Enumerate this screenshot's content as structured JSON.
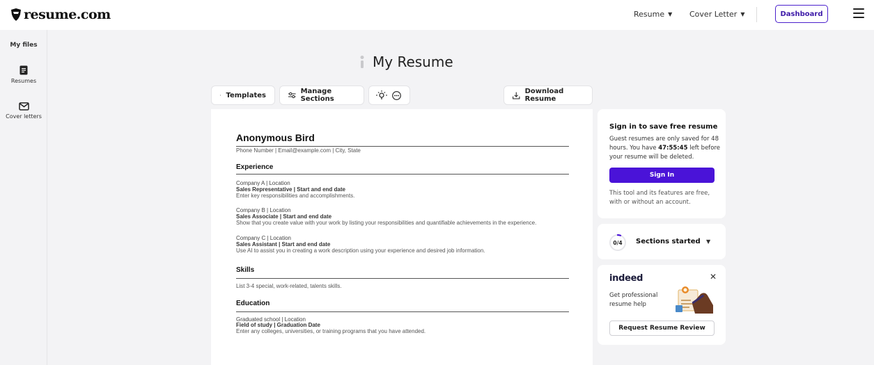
{
  "header": {
    "logo_text": "resume.com",
    "nav": [
      {
        "label": "Resume"
      },
      {
        "label": "Cover Letter"
      }
    ],
    "dashboard_label": "Dashboard"
  },
  "sidebar": {
    "title": "My files",
    "items": [
      {
        "label": "Resumes",
        "icon": "document-icon"
      },
      {
        "label": "Cover letters",
        "icon": "envelope-icon"
      }
    ]
  },
  "page": {
    "title": "My Resume"
  },
  "toolbar": {
    "templates_label": "Templates",
    "manage_sections_label": "Manage Sections",
    "download_label": "Download Resume"
  },
  "resume": {
    "name": "Anonymous Bird",
    "contact": "Phone Number | Email@example.com | City, State",
    "sections": {
      "experience": {
        "title": "Experience",
        "entries": [
          {
            "company": "Company A | Location",
            "role": "Sales Representative | Start and end date",
            "desc": "Enter key responsibilities and accomplishments."
          },
          {
            "company": "Company B | Location",
            "role": "Sales Associate | Start and end date",
            "desc": "Show that you create value with your work by listing your responsibilities and quantifiable achievements in the experience."
          },
          {
            "company": "Company C | Location",
            "role": "Sales Assistant | Start and end date",
            "desc": "Use AI to assist you in creating a work description using your experience and desired job information."
          }
        ]
      },
      "skills": {
        "title": "Skills",
        "desc": "List 3-4 special, work-related, talents skills."
      },
      "education": {
        "title": "Education",
        "school": "Graduated school | Location",
        "field": "Field of study | Graduation Date",
        "desc": "Enter any colleges, universities, or training programs that you have attended."
      }
    }
  },
  "signin_card": {
    "title": "Sign in to save free resume",
    "text_before": "Guest resumes are only saved for 48 hours. You have ",
    "timer": "47:55:45",
    "text_after": " left before your resume will be deleted.",
    "button": "Sign In",
    "note": "This tool and its features are free, with or without an account."
  },
  "sections_card": {
    "progress_label": "0/4",
    "progress_fraction": 0,
    "title": "Sections started"
  },
  "indeed_card": {
    "brand": "indeed",
    "text": "Get professional resume help",
    "button": "Request Resume Review"
  },
  "colors": {
    "primary": "#4a13d8",
    "page_bg": "#f3f3f5"
  }
}
